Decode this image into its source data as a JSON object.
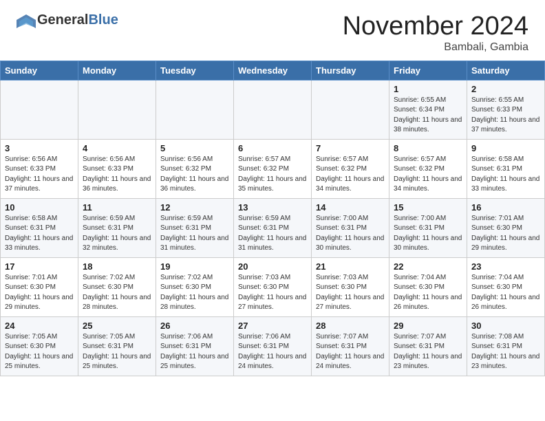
{
  "header": {
    "logo_general": "General",
    "logo_blue": "Blue",
    "month_title": "November 2024",
    "location": "Bambali, Gambia"
  },
  "weekdays": [
    "Sunday",
    "Monday",
    "Tuesday",
    "Wednesday",
    "Thursday",
    "Friday",
    "Saturday"
  ],
  "weeks": [
    [
      {
        "day": "",
        "info": ""
      },
      {
        "day": "",
        "info": ""
      },
      {
        "day": "",
        "info": ""
      },
      {
        "day": "",
        "info": ""
      },
      {
        "day": "",
        "info": ""
      },
      {
        "day": "1",
        "info": "Sunrise: 6:55 AM\nSunset: 6:34 PM\nDaylight: 11 hours\nand 38 minutes."
      },
      {
        "day": "2",
        "info": "Sunrise: 6:55 AM\nSunset: 6:33 PM\nDaylight: 11 hours\nand 37 minutes."
      }
    ],
    [
      {
        "day": "3",
        "info": "Sunrise: 6:56 AM\nSunset: 6:33 PM\nDaylight: 11 hours\nand 37 minutes."
      },
      {
        "day": "4",
        "info": "Sunrise: 6:56 AM\nSunset: 6:33 PM\nDaylight: 11 hours\nand 36 minutes."
      },
      {
        "day": "5",
        "info": "Sunrise: 6:56 AM\nSunset: 6:32 PM\nDaylight: 11 hours\nand 36 minutes."
      },
      {
        "day": "6",
        "info": "Sunrise: 6:57 AM\nSunset: 6:32 PM\nDaylight: 11 hours\nand 35 minutes."
      },
      {
        "day": "7",
        "info": "Sunrise: 6:57 AM\nSunset: 6:32 PM\nDaylight: 11 hours\nand 34 minutes."
      },
      {
        "day": "8",
        "info": "Sunrise: 6:57 AM\nSunset: 6:32 PM\nDaylight: 11 hours\nand 34 minutes."
      },
      {
        "day": "9",
        "info": "Sunrise: 6:58 AM\nSunset: 6:31 PM\nDaylight: 11 hours\nand 33 minutes."
      }
    ],
    [
      {
        "day": "10",
        "info": "Sunrise: 6:58 AM\nSunset: 6:31 PM\nDaylight: 11 hours\nand 33 minutes."
      },
      {
        "day": "11",
        "info": "Sunrise: 6:59 AM\nSunset: 6:31 PM\nDaylight: 11 hours\nand 32 minutes."
      },
      {
        "day": "12",
        "info": "Sunrise: 6:59 AM\nSunset: 6:31 PM\nDaylight: 11 hours\nand 31 minutes."
      },
      {
        "day": "13",
        "info": "Sunrise: 6:59 AM\nSunset: 6:31 PM\nDaylight: 11 hours\nand 31 minutes."
      },
      {
        "day": "14",
        "info": "Sunrise: 7:00 AM\nSunset: 6:31 PM\nDaylight: 11 hours\nand 30 minutes."
      },
      {
        "day": "15",
        "info": "Sunrise: 7:00 AM\nSunset: 6:31 PM\nDaylight: 11 hours\nand 30 minutes."
      },
      {
        "day": "16",
        "info": "Sunrise: 7:01 AM\nSunset: 6:30 PM\nDaylight: 11 hours\nand 29 minutes."
      }
    ],
    [
      {
        "day": "17",
        "info": "Sunrise: 7:01 AM\nSunset: 6:30 PM\nDaylight: 11 hours\nand 29 minutes."
      },
      {
        "day": "18",
        "info": "Sunrise: 7:02 AM\nSunset: 6:30 PM\nDaylight: 11 hours\nand 28 minutes."
      },
      {
        "day": "19",
        "info": "Sunrise: 7:02 AM\nSunset: 6:30 PM\nDaylight: 11 hours\nand 28 minutes."
      },
      {
        "day": "20",
        "info": "Sunrise: 7:03 AM\nSunset: 6:30 PM\nDaylight: 11 hours\nand 27 minutes."
      },
      {
        "day": "21",
        "info": "Sunrise: 7:03 AM\nSunset: 6:30 PM\nDaylight: 11 hours\nand 27 minutes."
      },
      {
        "day": "22",
        "info": "Sunrise: 7:04 AM\nSunset: 6:30 PM\nDaylight: 11 hours\nand 26 minutes."
      },
      {
        "day": "23",
        "info": "Sunrise: 7:04 AM\nSunset: 6:30 PM\nDaylight: 11 hours\nand 26 minutes."
      }
    ],
    [
      {
        "day": "24",
        "info": "Sunrise: 7:05 AM\nSunset: 6:30 PM\nDaylight: 11 hours\nand 25 minutes."
      },
      {
        "day": "25",
        "info": "Sunrise: 7:05 AM\nSunset: 6:31 PM\nDaylight: 11 hours\nand 25 minutes."
      },
      {
        "day": "26",
        "info": "Sunrise: 7:06 AM\nSunset: 6:31 PM\nDaylight: 11 hours\nand 25 minutes."
      },
      {
        "day": "27",
        "info": "Sunrise: 7:06 AM\nSunset: 6:31 PM\nDaylight: 11 hours\nand 24 minutes."
      },
      {
        "day": "28",
        "info": "Sunrise: 7:07 AM\nSunset: 6:31 PM\nDaylight: 11 hours\nand 24 minutes."
      },
      {
        "day": "29",
        "info": "Sunrise: 7:07 AM\nSunset: 6:31 PM\nDaylight: 11 hours\nand 23 minutes."
      },
      {
        "day": "30",
        "info": "Sunrise: 7:08 AM\nSunset: 6:31 PM\nDaylight: 11 hours\nand 23 minutes."
      }
    ]
  ]
}
